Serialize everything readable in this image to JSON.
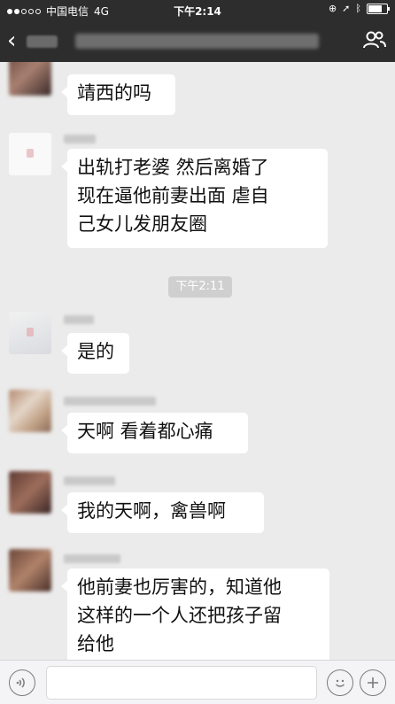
{
  "status_bar": {
    "carrier": "中国电信",
    "network": "4G",
    "time": "下午2:14"
  },
  "nav": {
    "back_icon": "chevron-left-icon",
    "group_icon": "people-icon"
  },
  "messages": [
    {
      "text": "靖西的吗"
    },
    {
      "text_lines": [
        "出轨打老婆  然后离婚了",
        "现在逼他前妻出面  虐自",
        "己女儿发朋友圈"
      ]
    },
    {
      "text": "是的"
    },
    {
      "text": "天啊  看着都心痛"
    },
    {
      "text": "我的天啊，禽兽啊"
    },
    {
      "text_lines": [
        "他前妻也厉害的，知道他",
        "这样的一个人还把孩子留",
        "给他"
      ]
    }
  ],
  "timestamp": "下午2:11",
  "input_bar": {
    "voice_icon": "voice-icon",
    "emoji_icon": "emoji-icon",
    "add_icon": "plus-icon"
  }
}
